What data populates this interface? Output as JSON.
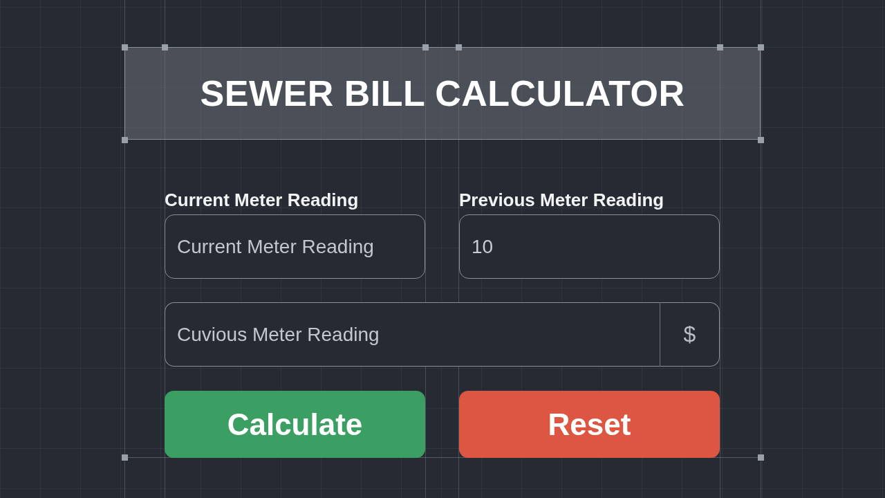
{
  "title": "SEWER BILL CALCULATOR",
  "fields": [
    {
      "label": "Current Meter Reading",
      "placeholder": "Current Meter Reading"
    },
    {
      "label": "Previous Meter Reading",
      "value": "10"
    }
  ],
  "amount_field": {
    "placeholder": "Cuvious Meter Reading",
    "suffix": "$"
  },
  "buttons": [
    {
      "label": "Calculate",
      "kind": "primary"
    },
    {
      "label": "Reset",
      "kind": "danger"
    }
  ]
}
